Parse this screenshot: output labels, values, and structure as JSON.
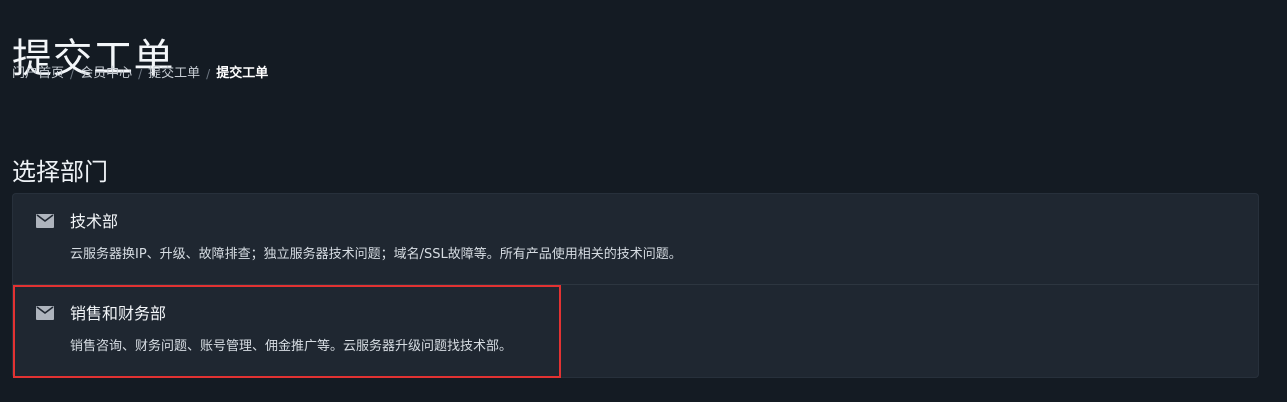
{
  "page": {
    "title": "提交工单",
    "breadcrumb": [
      "门户首页",
      "会员中心",
      "提交工单",
      "提交工单"
    ],
    "section_title": "选择部门"
  },
  "departments": [
    {
      "name": "技术部",
      "description": "云服务器换IP、升级、故障排查；独立服务器技术问题；域名/SSL故障等。所有产品使用相关的技术问题。",
      "icon": "mail-icon"
    },
    {
      "name": "销售和财务部",
      "description": "销售咨询、财务问题、账号管理、佣金推广等。云服务器升级问题找技术部。",
      "icon": "mail-icon"
    }
  ],
  "colors": {
    "background": "#141b23",
    "panel": "#1f2731",
    "divider": "#2d3640",
    "icon": "#aeb4bd",
    "highlight": "#e23232"
  }
}
